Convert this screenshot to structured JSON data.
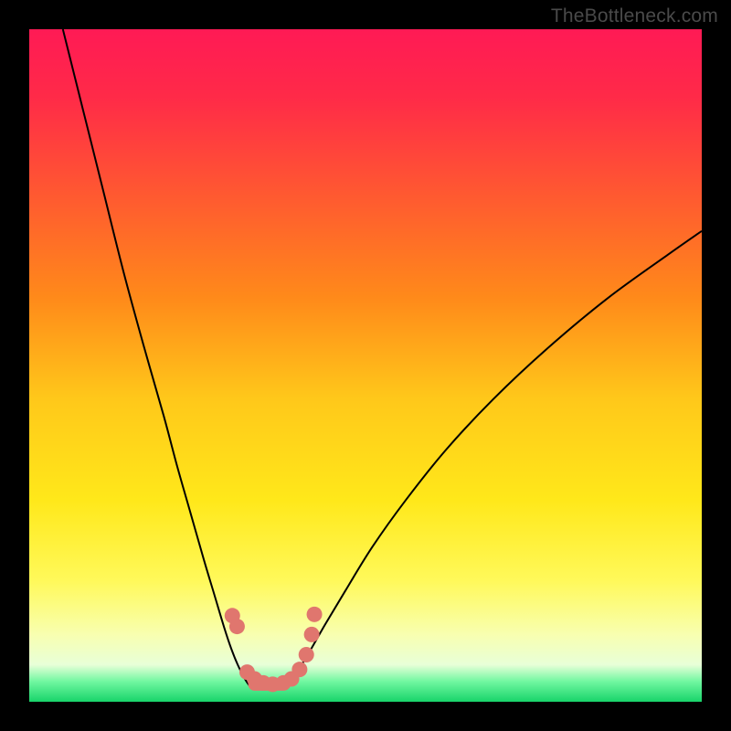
{
  "watermark": "TheBottleneck.com",
  "chart_data": {
    "type": "line",
    "title": "",
    "xlabel": "",
    "ylabel": "",
    "xlim": [
      0,
      100
    ],
    "ylim": [
      0,
      100
    ],
    "grid": false,
    "legend": false,
    "gradient_stops": [
      {
        "offset": 0.0,
        "color": "#ff1a55"
      },
      {
        "offset": 0.1,
        "color": "#ff2a48"
      },
      {
        "offset": 0.25,
        "color": "#ff5a30"
      },
      {
        "offset": 0.4,
        "color": "#ff8a1a"
      },
      {
        "offset": 0.55,
        "color": "#ffc81a"
      },
      {
        "offset": 0.7,
        "color": "#ffe81a"
      },
      {
        "offset": 0.82,
        "color": "#fff95a"
      },
      {
        "offset": 0.9,
        "color": "#f8ffb0"
      },
      {
        "offset": 0.945,
        "color": "#e8ffd8"
      },
      {
        "offset": 0.97,
        "color": "#70f7a0"
      },
      {
        "offset": 1.0,
        "color": "#18d46a"
      }
    ],
    "series": [
      {
        "name": "left-curve",
        "stroke": "#000000",
        "stroke_width": 2.0,
        "x": [
          5,
          8,
          11,
          14,
          17,
          20,
          22,
          24,
          26,
          27.5,
          29,
          30,
          31,
          32,
          33
        ],
        "y": [
          100,
          88,
          76,
          64,
          53,
          42.5,
          35,
          28,
          21,
          16,
          11,
          8,
          5.5,
          3.5,
          2
        ]
      },
      {
        "name": "right-curve",
        "stroke": "#000000",
        "stroke_width": 2.0,
        "x": [
          38,
          39,
          40.5,
          42,
          44,
          47,
          51,
          56,
          62,
          69,
          77,
          86,
          95,
          100
        ],
        "y": [
          2,
          3.5,
          5.5,
          8,
          11.5,
          16.5,
          23,
          30,
          37.5,
          45,
          52.5,
          60,
          66.5,
          70
        ]
      },
      {
        "name": "left-dot-cluster",
        "type": "scatter",
        "marker_color": "#e0766e",
        "marker_radius": 8.5,
        "x": [
          30.2,
          30.9,
          32.4,
          33.5,
          34.8,
          36.2
        ],
        "y": [
          12.8,
          11.2,
          4.4,
          3.4,
          2.8,
          2.6
        ]
      },
      {
        "name": "right-dot-cluster",
        "type": "scatter",
        "marker_color": "#e0766e",
        "marker_radius": 8.5,
        "x": [
          37.8,
          39.0,
          40.2,
          41.2,
          42.0,
          42.4
        ],
        "y": [
          2.8,
          3.4,
          4.8,
          7.0,
          10.0,
          13.0
        ]
      },
      {
        "name": "valley-floor",
        "stroke": "#e0766e",
        "stroke_width": 14,
        "linecap": "round",
        "x": [
          33.5,
          37.5
        ],
        "y": [
          2.6,
          2.6
        ]
      }
    ]
  }
}
